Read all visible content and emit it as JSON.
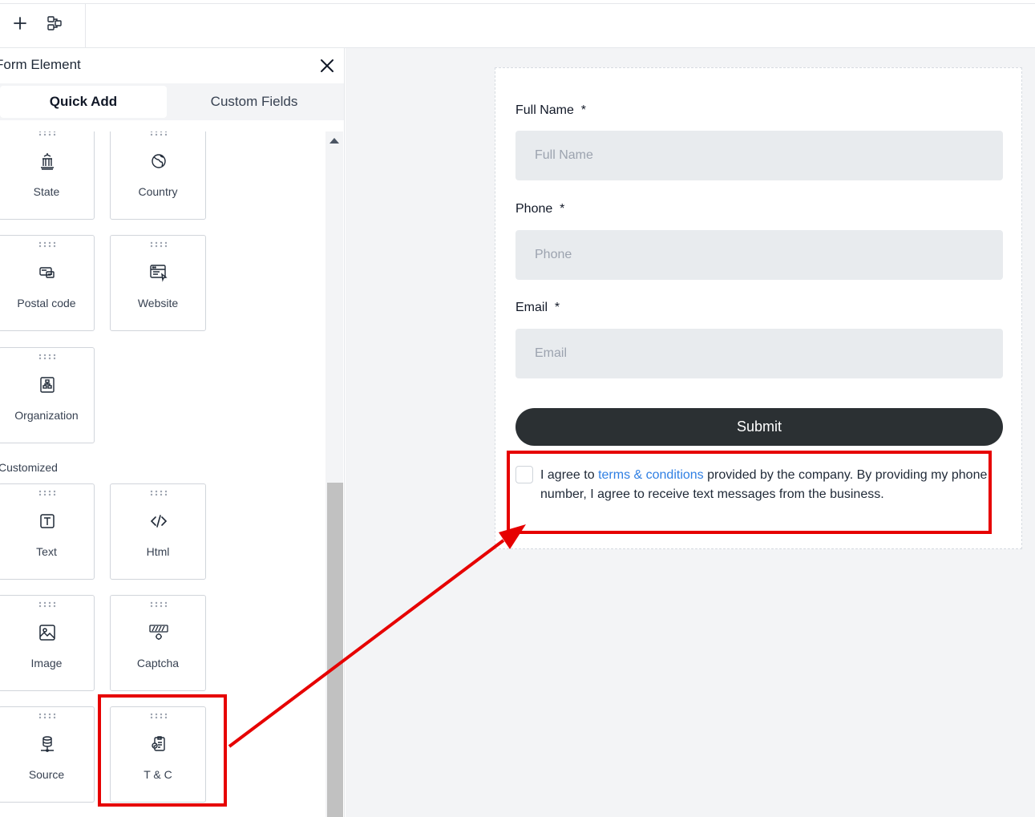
{
  "toolbar": {
    "add_icon": "plus-icon",
    "layout_icon": "layout-icon"
  },
  "panel": {
    "title": "Form Element",
    "tabs": [
      {
        "label": "Quick Add",
        "active": true
      },
      {
        "label": "Custom Fields",
        "active": false
      }
    ],
    "items": [
      {
        "label": "State",
        "icon": "bank-icon"
      },
      {
        "label": "Country",
        "icon": "globe-icon"
      },
      {
        "label": "Postal code",
        "icon": "mailbox-icon"
      },
      {
        "label": "Website",
        "icon": "browser-icon"
      },
      {
        "label": "Organization",
        "icon": "org-chart-icon"
      }
    ],
    "customized_label": "Customized",
    "customized_items": [
      {
        "label": "Text",
        "icon": "text-box-icon"
      },
      {
        "label": "Html",
        "icon": "code-icon"
      },
      {
        "label": "Image",
        "icon": "image-icon"
      },
      {
        "label": "Captcha",
        "icon": "captcha-icon"
      },
      {
        "label": "Source",
        "icon": "database-icon"
      },
      {
        "label": "T & C",
        "icon": "terms-icon"
      }
    ]
  },
  "form": {
    "fields": [
      {
        "label": "Full Name",
        "required_mark": "*",
        "placeholder": "Full Name"
      },
      {
        "label": "Phone",
        "required_mark": "*",
        "placeholder": "Phone"
      },
      {
        "label": "Email",
        "required_mark": "*",
        "placeholder": "Email"
      }
    ],
    "submit_label": "Submit",
    "terms": {
      "prefix": "I agree to",
      "link": "terms & conditions",
      "suffix": "provided by the company. By providing my phone number, I agree to receive text messages from the business."
    }
  },
  "colors": {
    "annotation": "#e60000",
    "link": "#2f7fe3",
    "submit_bg": "#2b3033"
  }
}
